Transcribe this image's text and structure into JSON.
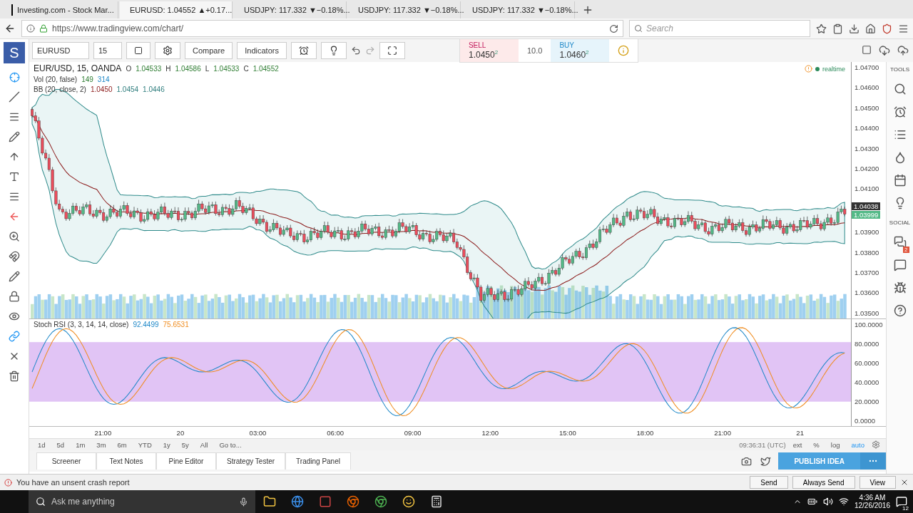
{
  "browser": {
    "tabs": [
      {
        "title": "Investing.com - Stock Mar...",
        "selected": false,
        "kind": "inv"
      },
      {
        "title": "EURUSD: 1.04552 ▲+0.17...",
        "selected": true,
        "kind": "tv"
      },
      {
        "title": "USDJPY: 117.332 ▼−0.18%...",
        "selected": false,
        "kind": "tv"
      },
      {
        "title": "USDJPY: 117.332 ▼−0.18%...",
        "selected": false,
        "kind": "tv"
      },
      {
        "title": "USDJPY: 117.332 ▼−0.18%...",
        "selected": false,
        "kind": "tv"
      }
    ],
    "url": "https://www.tradingview.com/chart/",
    "search_placeholder": "Search"
  },
  "logo": "S",
  "toolbar": {
    "symbol": "EURUSD",
    "interval": "15",
    "buttons": [
      "Compare",
      "Indicators"
    ]
  },
  "trade": {
    "sell_label": "SELL",
    "sell_price": "1.0450$^{2}$",
    "quantity": "10.0",
    "buy_label": "BUY",
    "buy_price": "1.0460$^{2}$"
  },
  "legend": {
    "title": "EUR/USD, 15, OANDA",
    "ohlc": [
      {
        "label": "O",
        "value": "1.04533"
      },
      {
        "label": "H",
        "value": "1.04586"
      },
      {
        "label": "L",
        "value": "1.04533"
      },
      {
        "label": "C",
        "value": "1.04552"
      }
    ],
    "indicators": [
      {
        "name": "Vol (20, false)",
        "values": [
          {
            "text": "149",
            "color": "#2e7d32"
          },
          {
            "text": "314",
            "color": "#1e88c8"
          }
        ]
      },
      {
        "name": "BB (20, close, 2)",
        "values": [
          {
            "text": "1.0450",
            "color": "#8b1a1a"
          },
          {
            "text": "1.0454",
            "color": "#2e7d7d"
          },
          {
            "text": "1.0446",
            "color": "#2e7d7d"
          }
        ]
      }
    ],
    "status": "realtime"
  },
  "price_axis": {
    "labels": [
      "1.04700",
      "1.04600",
      "1.04500",
      "1.04400",
      "1.04300",
      "1.04200",
      "1.04100",
      "1.03900",
      "1.03800",
      "1.03700",
      "1.03600",
      "1.03500"
    ],
    "cursor_price": "1.04038",
    "last_price": "1.03999"
  },
  "rsi": {
    "name": "Stoch RSI (3, 3, 14, 14, close)",
    "values": [
      {
        "text": "92.4499",
        "color": "#1e88c8"
      },
      {
        "text": "75.6531",
        "color": "#f08c1e"
      }
    ],
    "labels": [
      "100.0000",
      "80.0000",
      "60.0000",
      "40.0000",
      "20.0000",
      "0.0000"
    ]
  },
  "time_axis": [
    "21:00",
    "20",
    "03:00",
    "06:00",
    "09:00",
    "12:00",
    "15:00",
    "18:00",
    "21:00",
    "21"
  ],
  "ranges": [
    "1d",
    "5d",
    "1m",
    "3m",
    "6m",
    "YTD",
    "1y",
    "5y",
    "All",
    "Go to..."
  ],
  "clock": "09:36:31 (UTC)",
  "scale_options": [
    {
      "label": "ext",
      "selected": false
    },
    {
      "label": "%",
      "selected": false
    },
    {
      "label": "log",
      "selected": false
    },
    {
      "label": "auto",
      "selected": true
    }
  ],
  "bottom_tabs": [
    "Screener",
    "Text Notes",
    "Pine Editor",
    "Strategy Tester",
    "Trading Panel"
  ],
  "publish": "PUBLISH IDEA",
  "sidebar": {
    "tools_label": "TOOLS",
    "social_label": "SOCIAL",
    "chat_badge": "2"
  },
  "crash_bar": {
    "message": "You have an unsent crash report",
    "buttons": [
      "Send",
      "Always Send",
      "View"
    ]
  },
  "taskbar": {
    "search_placeholder": "Ask me anything",
    "time": "4:36 AM",
    "date": "12/26/2016",
    "notifications": "12"
  }
}
